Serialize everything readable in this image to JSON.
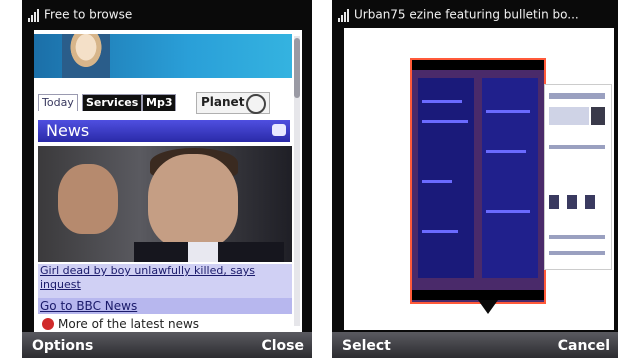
{
  "left_screen": {
    "status_title": "Free to browse",
    "tabs": [
      {
        "label": "Today"
      },
      {
        "label": "Services"
      },
      {
        "label": "Mp3"
      },
      {
        "label": "Planet"
      }
    ],
    "section_title": "News",
    "headline": "Girl dead by boy unlawfully killed, says inquest",
    "bbc_link": "Go to BBC News",
    "more_text": "More of the latest news",
    "softkey_left": "Options",
    "softkey_right": "Close"
  },
  "right_screen": {
    "status_title": "Urban75 ezine featuring bulletin bo...",
    "softkey_left": "Select",
    "softkey_right": "Cancel"
  }
}
